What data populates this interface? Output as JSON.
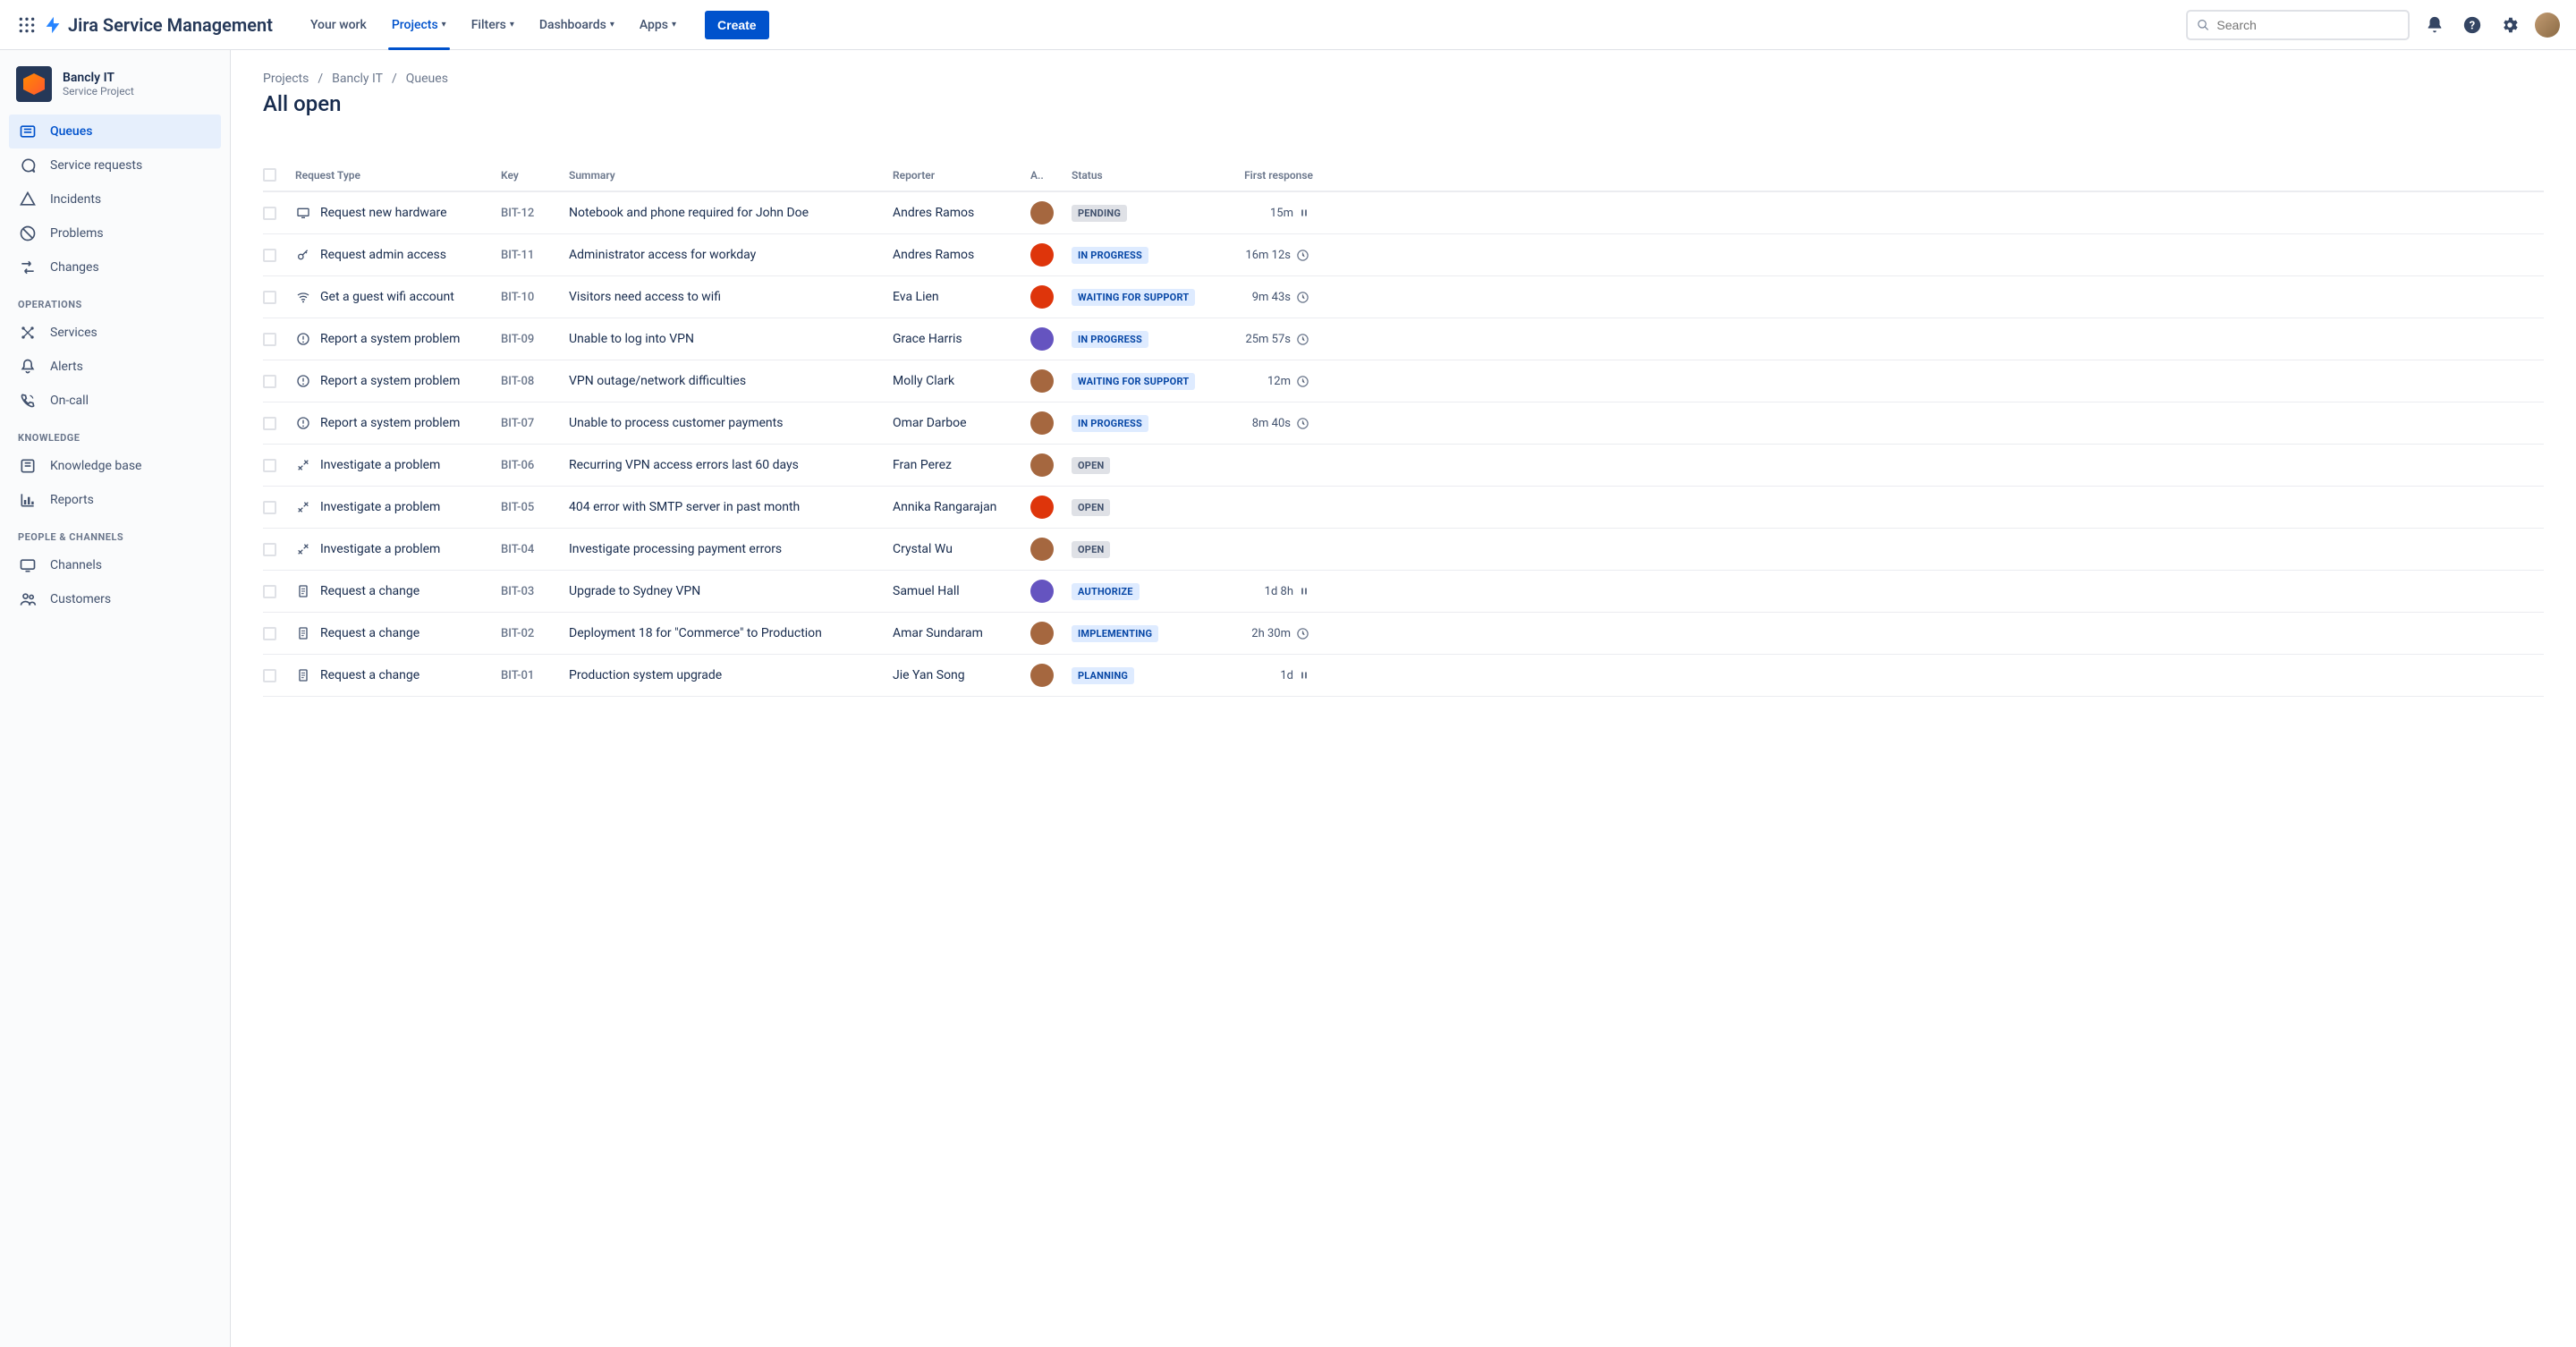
{
  "brand": "Jira Service Management",
  "nav": {
    "your_work": "Your work",
    "projects": "Projects",
    "filters": "Filters",
    "dashboards": "Dashboards",
    "apps": "Apps",
    "create": "Create"
  },
  "search_placeholder": "Search",
  "project": {
    "name": "Bancly IT",
    "subtitle": "Service Project"
  },
  "sidebar": {
    "queues": "Queues",
    "service_requests": "Service requests",
    "incidents": "Incidents",
    "problems": "Problems",
    "changes": "Changes",
    "section_operations": "OPERATIONS",
    "services": "Services",
    "alerts": "Alerts",
    "on_call": "On-call",
    "section_knowledge": "KNOWLEDGE",
    "knowledge_base": "Knowledge base",
    "reports": "Reports",
    "section_people": "PEOPLE & CHANNELS",
    "channels": "Channels",
    "customers": "Customers"
  },
  "breadcrumb": {
    "projects": "Projects",
    "project": "Bancly IT",
    "current": "Queues"
  },
  "page_title": "All open",
  "columns": {
    "request_type": "Request Type",
    "key": "Key",
    "summary": "Summary",
    "reporter": "Reporter",
    "assignee": "A..",
    "status": "Status",
    "first_response": "First response"
  },
  "rows": [
    {
      "type": "Request new hardware",
      "icon": "monitor",
      "key": "BIT-12",
      "summary": "Notebook and phone required for John Doe",
      "reporter": "Andres Ramos",
      "av": "#a5673f",
      "status": "PENDING",
      "statusStyle": "default",
      "resp": "15m",
      "respIcon": "pause"
    },
    {
      "type": "Request admin access",
      "icon": "key",
      "key": "BIT-11",
      "summary": "Administrator access for workday",
      "reporter": "Andres Ramos",
      "av": "#de350b",
      "status": "IN PROGRESS",
      "statusStyle": "blue",
      "resp": "16m 12s",
      "respIcon": "clock"
    },
    {
      "type": "Get a guest wifi account",
      "icon": "wifi",
      "key": "BIT-10",
      "summary": "Visitors need access to wifi",
      "reporter": "Eva Lien",
      "av": "#de350b",
      "status": "WAITING FOR SUPPORT",
      "statusStyle": "blue",
      "resp": "9m 43s",
      "respIcon": "clock"
    },
    {
      "type": "Report a system problem",
      "icon": "alert",
      "key": "BIT-09",
      "summary": "Unable to log into VPN",
      "reporter": "Grace Harris",
      "av": "#6554c0",
      "status": "IN PROGRESS",
      "statusStyle": "blue",
      "resp": "25m 57s",
      "respIcon": "clock"
    },
    {
      "type": "Report a system problem",
      "icon": "alert",
      "key": "BIT-08",
      "summary": "VPN outage/network difficulties",
      "reporter": "Molly Clark",
      "av": "#a5673f",
      "status": "WAITING FOR SUPPORT",
      "statusStyle": "blue",
      "resp": "12m",
      "respIcon": "clock"
    },
    {
      "type": "Report a system problem",
      "icon": "alert",
      "key": "BIT-07",
      "summary": "Unable to process customer payments",
      "reporter": "Omar Darboe",
      "av": "#a5673f",
      "status": "IN PROGRESS",
      "statusStyle": "blue",
      "resp": "8m 40s",
      "respIcon": "clock"
    },
    {
      "type": "Investigate a problem",
      "icon": "tools",
      "key": "BIT-06",
      "summary": "Recurring VPN access errors last 60 days",
      "reporter": "Fran Perez",
      "av": "#a5673f",
      "status": "OPEN",
      "statusStyle": "default",
      "resp": "",
      "respIcon": ""
    },
    {
      "type": "Investigate a problem",
      "icon": "tools",
      "key": "BIT-05",
      "summary": "404 error with SMTP server in past month",
      "reporter": "Annika Rangarajan",
      "av": "#de350b",
      "status": "OPEN",
      "statusStyle": "default",
      "resp": "",
      "respIcon": ""
    },
    {
      "type": "Investigate a problem",
      "icon": "tools",
      "key": "BIT-04",
      "summary": "Investigate processing payment errors",
      "reporter": "Crystal Wu",
      "av": "#a5673f",
      "status": "OPEN",
      "statusStyle": "default",
      "resp": "",
      "respIcon": ""
    },
    {
      "type": "Request a change",
      "icon": "doc",
      "key": "BIT-03",
      "summary": "Upgrade to Sydney VPN",
      "reporter": "Samuel Hall",
      "av": "#6554c0",
      "status": "AUTHORIZE",
      "statusStyle": "blue",
      "resp": "1d 8h",
      "respIcon": "pause"
    },
    {
      "type": "Request a change",
      "icon": "doc",
      "key": "BIT-02",
      "summary": "Deployment 18 for \"Commerce\" to Production",
      "reporter": "Amar Sundaram",
      "av": "#a5673f",
      "status": "IMPLEMENTING",
      "statusStyle": "blue",
      "resp": "2h 30m",
      "respIcon": "clock"
    },
    {
      "type": "Request a change",
      "icon": "doc",
      "key": "BIT-01",
      "summary": "Production system upgrade",
      "reporter": "Jie Yan Song",
      "av": "#a5673f",
      "status": "PLANNING",
      "statusStyle": "blue",
      "resp": "1d",
      "respIcon": "pause"
    }
  ]
}
